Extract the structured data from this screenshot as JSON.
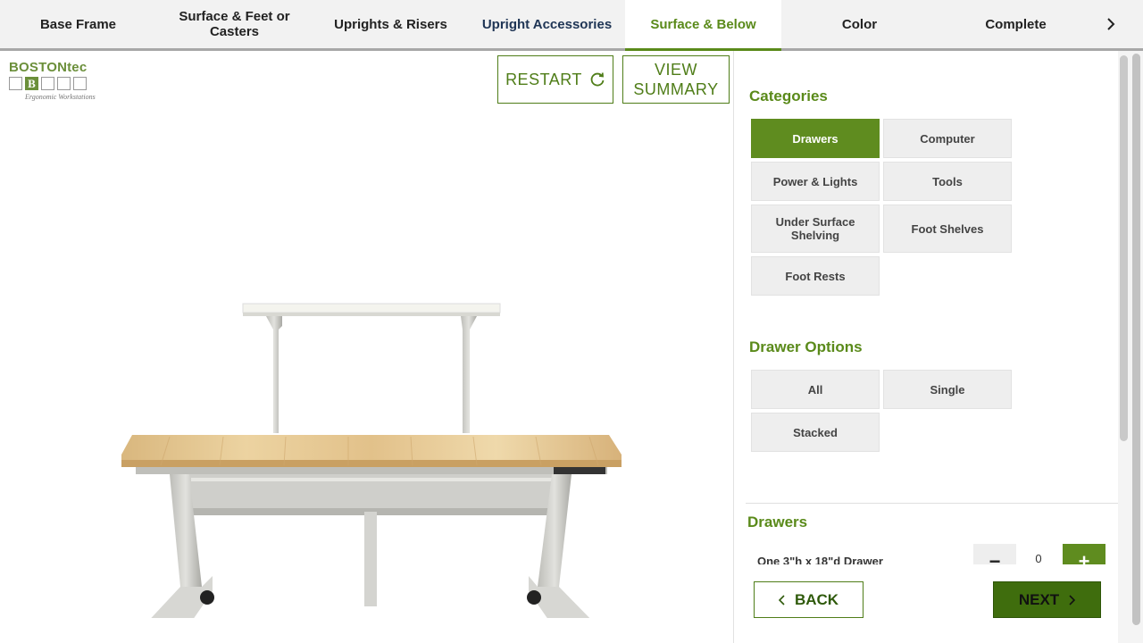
{
  "tabs": [
    {
      "label": "Base Frame"
    },
    {
      "label": "Surface & Feet or Casters"
    },
    {
      "label": "Uprights & Risers"
    },
    {
      "label": "Upright Accessories"
    },
    {
      "label": "Surface & Below"
    },
    {
      "label": "Color"
    },
    {
      "label": "Complete"
    }
  ],
  "active_tab": "Surface & Below",
  "logo": {
    "brand": "BOSTONtec",
    "letter": "B",
    "tagline": "Ergonomic Workstations"
  },
  "viewer": {
    "restart_label": "RESTART",
    "summary_label": "VIEW SUMMARY"
  },
  "categories": {
    "title": "Categories",
    "items": [
      {
        "label": "Drawers",
        "selected": true
      },
      {
        "label": "Computer",
        "selected": false
      },
      {
        "label": "Power & Lights",
        "selected": false
      },
      {
        "label": "Tools",
        "selected": false
      },
      {
        "label": "Under Surface Shelving",
        "selected": false
      },
      {
        "label": "Foot Shelves",
        "selected": false
      },
      {
        "label": "Foot Rests",
        "selected": false
      }
    ]
  },
  "drawer_options": {
    "title": "Drawer Options",
    "items": [
      {
        "label": "All"
      },
      {
        "label": "Single"
      },
      {
        "label": "Stacked"
      }
    ]
  },
  "drawers": {
    "title": "Drawers",
    "items": [
      {
        "label": "One 3\"h x 18\"d Drawer",
        "quantity": "0",
        "minus": "−",
        "plus": "+"
      }
    ]
  },
  "footer": {
    "back_label": "BACK",
    "next_label": "NEXT"
  },
  "colors": {
    "accent": "#5a8a1a",
    "selected_bg": "#5f8c1f",
    "next_bg": "#3f6d0d"
  }
}
